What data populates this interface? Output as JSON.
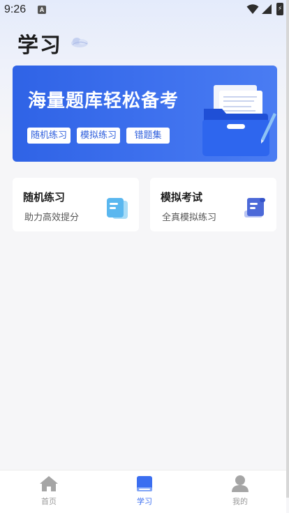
{
  "status_bar": {
    "time": "9:26",
    "notif_badge": "A"
  },
  "header": {
    "title": "学习",
    "decor_icon": "cloud-icon"
  },
  "banner": {
    "title": "海量题库轻松备考",
    "chips": [
      "随机练习",
      "模拟练习",
      "错题集"
    ],
    "accent": "#3468e8"
  },
  "cards": [
    {
      "title": "随机练习",
      "subtitle": "助力高效提分",
      "icon": "document-icon"
    },
    {
      "title": "模拟考试",
      "subtitle": "全真模拟练习",
      "icon": "scroll-icon"
    }
  ],
  "tab_bar": {
    "items": [
      {
        "label": "首页",
        "icon": "home-icon",
        "active": false
      },
      {
        "label": "学习",
        "icon": "book-icon",
        "active": true
      },
      {
        "label": "我的",
        "icon": "user-icon",
        "active": false
      }
    ],
    "active_color": "#3b6ef0",
    "inactive_color": "#9a9a9a"
  }
}
